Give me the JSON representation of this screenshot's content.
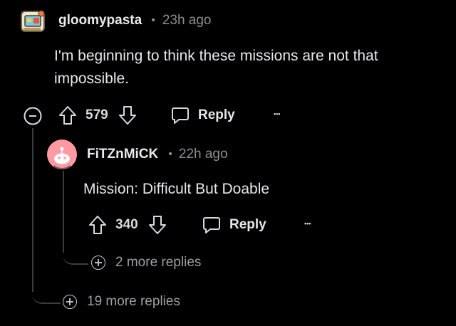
{
  "comment": {
    "username": "gloomypasta",
    "separator": "•",
    "time": "23h ago",
    "text": "I'm beginning to think these missions are not that impossible.",
    "votes": "579",
    "reply_label": "Reply",
    "more_label": "•••",
    "icons": [
      "collapse-icon",
      "upvote-icon",
      "downvote-icon",
      "reply-bubble-icon",
      "overflow-icon"
    ]
  },
  "reply": {
    "username": "FiTZnMiCK",
    "separator": "•",
    "time": "22h ago",
    "text": "Mission: Difficult But Doable",
    "votes": "340",
    "reply_label": "Reply",
    "more_label": "•••",
    "more_replies": "2 more replies"
  },
  "thread": {
    "more_replies": "19 more replies"
  },
  "colors": {
    "background": "#000000",
    "text": "#d7dadc",
    "muted": "#8b8f93",
    "line": "#3a3d40",
    "avatar_pink": "#ff9aa2"
  }
}
